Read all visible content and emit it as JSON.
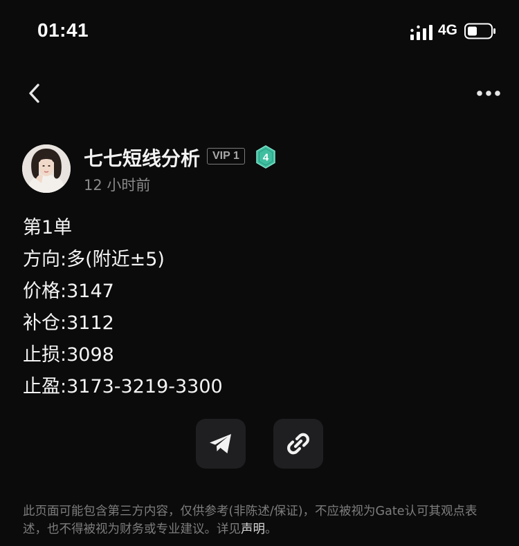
{
  "status_bar": {
    "time": "01:41",
    "network": "4G"
  },
  "author": {
    "name": "七七短线分析",
    "vip_label": "VIP 1",
    "level": "4",
    "post_time": "12 小时前"
  },
  "post": {
    "lines": [
      "第1单",
      "方向:多(附近±5)",
      "价格:3147",
      "补仓:3112",
      "止损:3098",
      "止盈:3173-3219-3300"
    ]
  },
  "disclaimer": {
    "text": "此页面可能包含第三方内容，仅供参考(非陈述/保证)，不应被视为Gate认可其观点表述，也不得被视为财务或专业建议。详见",
    "link_label": "声明",
    "suffix": "。"
  },
  "colors": {
    "background": "#0b0b0c",
    "level_badge": "#3fbfa0",
    "button_bg": "#1f1f21"
  },
  "icons": {
    "back": "chevron-left-icon",
    "more": "more-horizontal-icon",
    "share": "telegram-icon",
    "link": "link-icon"
  }
}
